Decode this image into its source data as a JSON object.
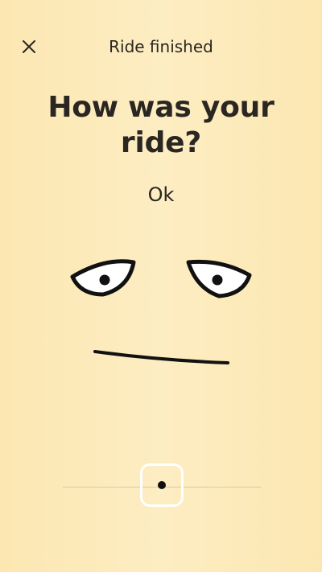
{
  "header": {
    "title": "Ride finished",
    "close_icon": "close-icon"
  },
  "question": {
    "text": "How was your ride?"
  },
  "rating": {
    "label": "Ok",
    "level": 0.5
  },
  "colors": {
    "background": "#FCE9B6",
    "text": "#2a2621",
    "thumb_border": "#ffffff"
  }
}
